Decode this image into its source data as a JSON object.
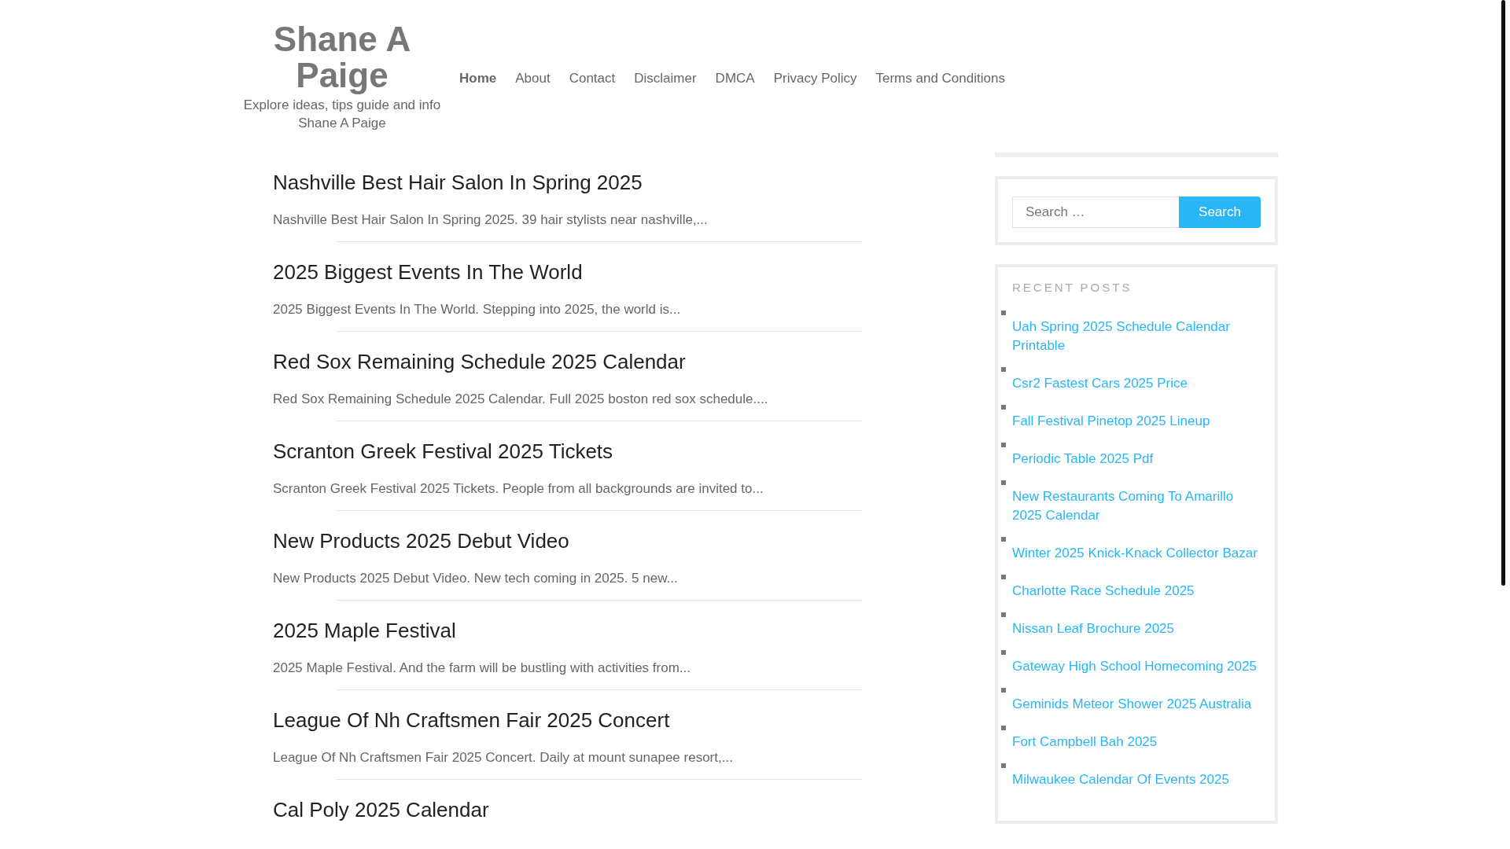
{
  "site": {
    "title": "Shane A Paige",
    "tagline": "Explore ideas, tips guide and info Shane A Paige"
  },
  "nav": [
    {
      "label": "Home",
      "selected": true
    },
    {
      "label": "About",
      "selected": false
    },
    {
      "label": "Contact",
      "selected": false
    },
    {
      "label": "Disclaimer",
      "selected": false
    },
    {
      "label": "DMCA",
      "selected": false
    },
    {
      "label": "Privacy Policy",
      "selected": false
    },
    {
      "label": "Terms and Conditions",
      "selected": false
    }
  ],
  "posts": [
    {
      "title": "Nashville Best Hair Salon In Spring 2025",
      "excerpt": "Nashville Best Hair Salon In Spring 2025. 39 hair stylists near nashville,..."
    },
    {
      "title": "2025 Biggest Events In The World",
      "excerpt": "2025 Biggest Events In The World. Stepping into 2025, the world is..."
    },
    {
      "title": "Red Sox Remaining Schedule 2025 Calendar",
      "excerpt": "Red Sox Remaining Schedule 2025 Calendar. Full 2025 boston red sox schedule...."
    },
    {
      "title": "Scranton Greek Festival 2025 Tickets",
      "excerpt": "Scranton Greek Festival 2025 Tickets. People from all backgrounds are invited to..."
    },
    {
      "title": "New Products 2025 Debut Video",
      "excerpt": "New Products 2025 Debut Video. New tech coming in 2025. 5 new..."
    },
    {
      "title": "2025 Maple Festival",
      "excerpt": "2025 Maple Festival. And the farm will be bustling with activities from..."
    },
    {
      "title": "League Of Nh Craftsmen Fair 2025 Concert",
      "excerpt": "League Of Nh Craftsmen Fair 2025 Concert. Daily at mount sunapee resort,..."
    },
    {
      "title": "Cal Poly 2025 Calendar"
    }
  ],
  "sidebar": {
    "search": {
      "placeholder": "Search …",
      "button": "Search"
    },
    "recent_posts": {
      "heading": "RECENT POSTS",
      "items": [
        "Uah Spring 2025 Schedule Calendar Printable",
        "Csr2 Fastest Cars 2025 Price",
        "Fall Festival Pinetop 2025 Lineup",
        "Periodic Table 2025 Pdf",
        "New Restaurants Coming To Amarillo 2025 Calendar",
        "Winter 2025 Knick-Knack Collector Bazar",
        "Charlotte Race Schedule 2025",
        "Nissan Leaf Brochure 2025",
        "Gateway High School Homecoming 2025",
        "Geminids Meteor Shower 2025 Australia",
        "Fort Campbell Bah 2025",
        "Milwaukee Calendar Of Events 2025"
      ]
    }
  }
}
